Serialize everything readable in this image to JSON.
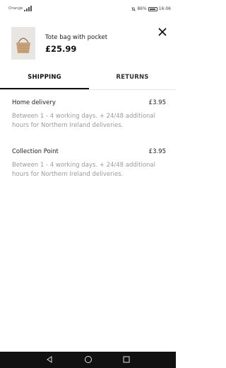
{
  "status_bar": {
    "carrier": "Orange",
    "battery": "86%",
    "time": "16:06"
  },
  "product": {
    "name": "Tote bag with pocket",
    "price": "£25.99"
  },
  "tabs": [
    {
      "label": "SHIPPING",
      "active": true
    },
    {
      "label": "RETURNS",
      "active": false
    }
  ],
  "shipping_options": [
    {
      "title": "Home delivery",
      "price": "£3.95",
      "description": "Between 1 - 4 working days. + 24/48 additional hours for Northern Ireland deliveries."
    },
    {
      "title": "Collection Point",
      "price": "£3.95",
      "description": "Between 1 - 4 working days. + 24/48 additional hours for Northern Ireland deliveries."
    }
  ],
  "icons": {
    "close": "close-icon",
    "back": "back-icon",
    "home": "home-icon",
    "recent": "recent-apps-icon"
  }
}
